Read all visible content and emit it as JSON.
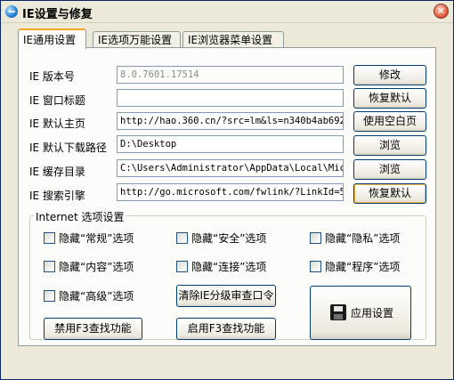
{
  "window": {
    "title": "IE设置与修复",
    "close_glyph": "✕"
  },
  "tabs": [
    {
      "label": "IE通用设置",
      "active": true
    },
    {
      "label": "IE选项万能设置",
      "active": false
    },
    {
      "label": "IE浏览器菜单设置",
      "active": false
    }
  ],
  "rows": [
    {
      "label": "IE 版本号",
      "value": "8.0.7601.17514",
      "button": "修改"
    },
    {
      "label": "IE 窗口标题",
      "value": "",
      "button": "恢复默认"
    },
    {
      "label": "IE 默认主页",
      "value": "http://hao.360.cn/?src=lm&ls=n340b4ab692",
      "button": "使用空白页"
    },
    {
      "label": "IE 默认下载路径",
      "value": "D:\\Desktop",
      "button": "浏览"
    },
    {
      "label": "IE 缓存目录",
      "value": "C:\\Users\\Administrator\\AppData\\Local\\Micro",
      "button": "浏览"
    },
    {
      "label": "IE 搜索引擎",
      "value": "http://go.microsoft.com/fwlink/?LinkId=546",
      "button": "恢复默认"
    }
  ],
  "options_group": {
    "title": "Internet 选项设置",
    "checkboxes": [
      "隐藏“常规”选项",
      "隐藏“安全”选项",
      "隐藏“隐私”选项",
      "隐藏“内容”选项",
      "隐藏“连接”选项",
      "隐藏“程序”选项",
      "隐藏“高级”选项"
    ],
    "clear_button": "清除IE分级审查口令",
    "disable_f3": "禁用F3查找功能",
    "enable_f3": "启用F3查找功能",
    "apply": {
      "label": "应用设置",
      "icon": "save-disk-icon"
    }
  }
}
